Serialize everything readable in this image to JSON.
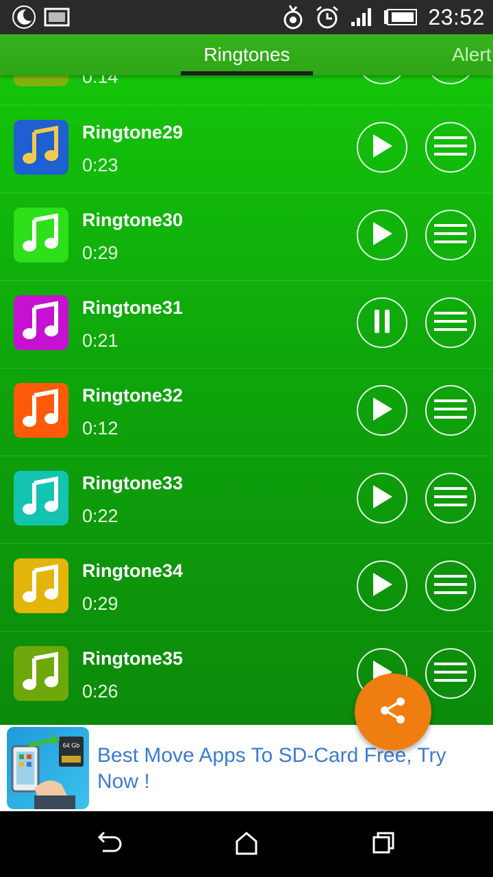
{
  "status_bar": {
    "time": "23:52",
    "left_icons": [
      "night-mode-icon",
      "image-icon"
    ],
    "right_icons": [
      "sync-icon",
      "alarm-icon",
      "signal-icon",
      "battery-icon"
    ]
  },
  "tabs": [
    {
      "label": "Ringtones",
      "selected": true
    },
    {
      "label": "Alert",
      "selected": false
    }
  ],
  "colors": {
    "list_top": "#14c40a",
    "list_bottom": "#0c8a0b",
    "tab_bar": "#36b21c",
    "fab": "#f07d10",
    "ad_text": "#3a7bd5"
  },
  "partial_row": {
    "duration": "0:14",
    "thumb_color": "#7fb20a"
  },
  "ringtones": [
    {
      "title": "Ringtone29",
      "duration": "0:23",
      "thumb_color": "#1e5fd1",
      "note_color": "#f2c94c",
      "state": "play"
    },
    {
      "title": "Ringtone30",
      "duration": "0:29",
      "thumb_color": "#2de01a",
      "note_color": "#ffffff",
      "state": "play"
    },
    {
      "title": "Ringtone31",
      "duration": "0:21",
      "thumb_color": "#c611d2",
      "note_color": "#ffffff",
      "state": "pause"
    },
    {
      "title": "Ringtone32",
      "duration": "0:12",
      "thumb_color": "#ff5a0a",
      "note_color": "#ffffff",
      "state": "play"
    },
    {
      "title": "Ringtone33",
      "duration": "0:22",
      "thumb_color": "#14c3b0",
      "note_color": "#ffffff",
      "state": "play"
    },
    {
      "title": "Ringtone34",
      "duration": "0:29",
      "thumb_color": "#e3b50a",
      "note_color": "#ffffff",
      "state": "play"
    },
    {
      "title": "Ringtone35",
      "duration": "0:26",
      "thumb_color": "#6ea80a",
      "note_color": "#ffffff",
      "state": "play"
    }
  ],
  "fab": {
    "icon": "share-icon"
  },
  "ad": {
    "text": "Best Move Apps To SD-Card Free, Try Now !",
    "image_label": "64 Gb"
  },
  "nav_bar": {
    "icons": [
      "back-icon",
      "home-icon",
      "recents-icon"
    ]
  }
}
